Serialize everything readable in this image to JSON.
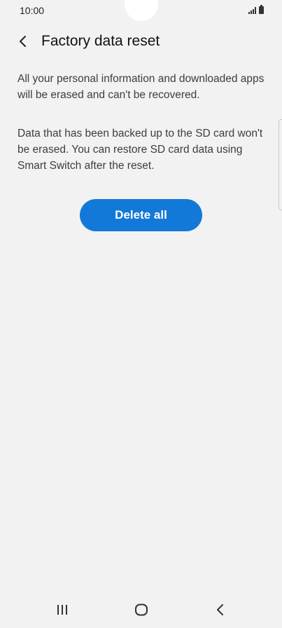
{
  "status_bar": {
    "time": "10:00"
  },
  "app_bar": {
    "title": "Factory data reset",
    "back_icon": "chevron-left-icon"
  },
  "content": {
    "paragraph_1": "All your personal information and downloaded apps will be erased and can't be recovered.",
    "paragraph_2": "Data that has been backed up to the SD card won't be erased. You can restore SD card data using Smart Switch after the reset.",
    "delete_button_label": "Delete all"
  },
  "nav_bar": {
    "recents_icon": "recents-icon",
    "home_icon": "home-icon",
    "back_icon": "back-icon"
  },
  "colors": {
    "background": "#f2f2f2",
    "accent": "#1279d9",
    "text_primary": "#111111",
    "text_secondary": "#3d3d3d"
  }
}
